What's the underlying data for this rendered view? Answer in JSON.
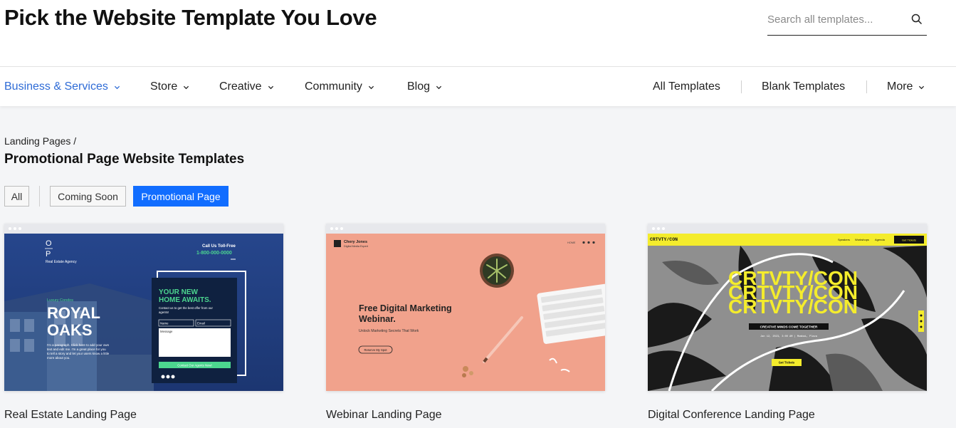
{
  "header": {
    "title": "Pick the Website Template You Love",
    "search_placeholder": "Search all templates..."
  },
  "nav": {
    "left": [
      {
        "label": "Business & Services",
        "active": true
      },
      {
        "label": "Store"
      },
      {
        "label": "Creative"
      },
      {
        "label": "Community"
      },
      {
        "label": "Blog"
      }
    ],
    "right": [
      {
        "label": "All Templates"
      },
      {
        "label": "Blank Templates"
      },
      {
        "label": "More"
      }
    ]
  },
  "breadcrumb": "Landing Pages /",
  "page_title": "Promotional Page Website Templates",
  "filters": [
    "All",
    "Coming Soon",
    "Promotional Page"
  ],
  "active_filter": "Promotional Page",
  "colors": {
    "accent": "#116dff",
    "nav_active": "#2e6bd6"
  },
  "cards": [
    {
      "caption": "Real Estate Landing Page",
      "thumb": {
        "logo_top": "O",
        "logo_bottom": "P",
        "agency": "Real Estate Agency",
        "call": "Call Us Toll-Free",
        "phone": "1-800-000-0000",
        "kicker": "Luxury Condos",
        "name1": "ROYAL",
        "name2": "OAKS",
        "para1": "I'm a paragraph. Click here to add your own",
        "para2": "text and edit me. I'm a great place for you",
        "para3": "to tell a story and let your users know a little",
        "para4": "more about you.",
        "form_h1": "YOUR NEW",
        "form_h2": "HOME AWAITS.",
        "form_sub1": "Contact us to get the best offer from our",
        "form_sub2": "agents!",
        "f_name": "Name",
        "f_email": "Email",
        "f_message": "Message",
        "f_button": "Contact Our Agents Now!"
      }
    },
    {
      "caption": "Webinar Landing Page",
      "thumb": {
        "brand": "Chery Jones",
        "brand_sub": "Digital Media Expert",
        "nav_home": "HOME",
        "title1": "Free Digital Marketing",
        "title2": "Webinar.",
        "sub": "Unlock Marketing Secrets That Work",
        "button": "Reserve My Spot"
      }
    },
    {
      "caption": "Digital Conference Landing Page",
      "thumb": {
        "logo": "CRTVTY/CON",
        "nav1": "Speakers",
        "nav2": "Workshops",
        "nav3": "Agenda",
        "cta": "Get Tickets",
        "headline": "CRTVTY/CON",
        "tagline": "CREATIVE MINDS COME TOGETHER",
        "date": "Jan 12, 2023, 3:00 AM | Mumbai, Plaza",
        "button": "Get Tickets"
      }
    }
  ]
}
